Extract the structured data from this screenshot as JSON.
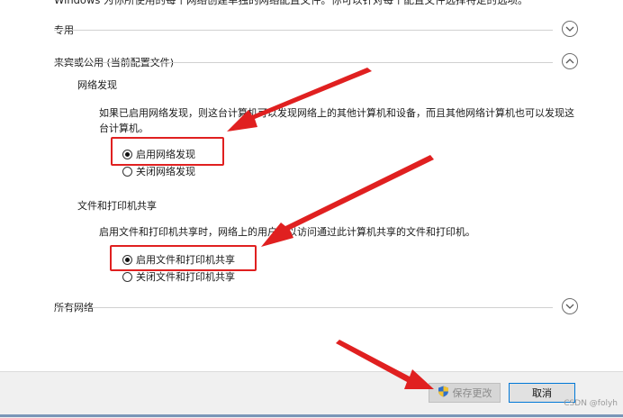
{
  "intro_text": "Windows 为你所使用的每个网络创建单独的网络配置文件。你可以针对每个配置文件选择特定的选项。",
  "sections": {
    "private": {
      "label": "专用"
    },
    "guest_public": {
      "label": "来宾或公用 (当前配置文件)"
    },
    "all_networks": {
      "label": "所有网络"
    }
  },
  "network_discovery": {
    "heading": "网络发现",
    "description": "如果已启用网络发现，则这台计算机可以发现网络上的其他计算机和设备，而且其他网络计算机也可以发现这台计算机。",
    "options": [
      {
        "label": "启用网络发现",
        "checked": true
      },
      {
        "label": "关闭网络发现",
        "checked": false
      }
    ]
  },
  "file_printer_sharing": {
    "heading": "文件和打印机共享",
    "description": "启用文件和打印机共享时，网络上的用户可以访问通过此计算机共享的文件和打印机。",
    "options": [
      {
        "label": "启用文件和打印机共享",
        "checked": true
      },
      {
        "label": "关闭文件和打印机共享",
        "checked": false
      }
    ]
  },
  "footer": {
    "save_label": "保存更改",
    "cancel_label": "取消"
  },
  "watermark": "CSDN @folyh",
  "colors": {
    "annotation_red": "#e02020",
    "accent_blue": "#0078d7"
  }
}
